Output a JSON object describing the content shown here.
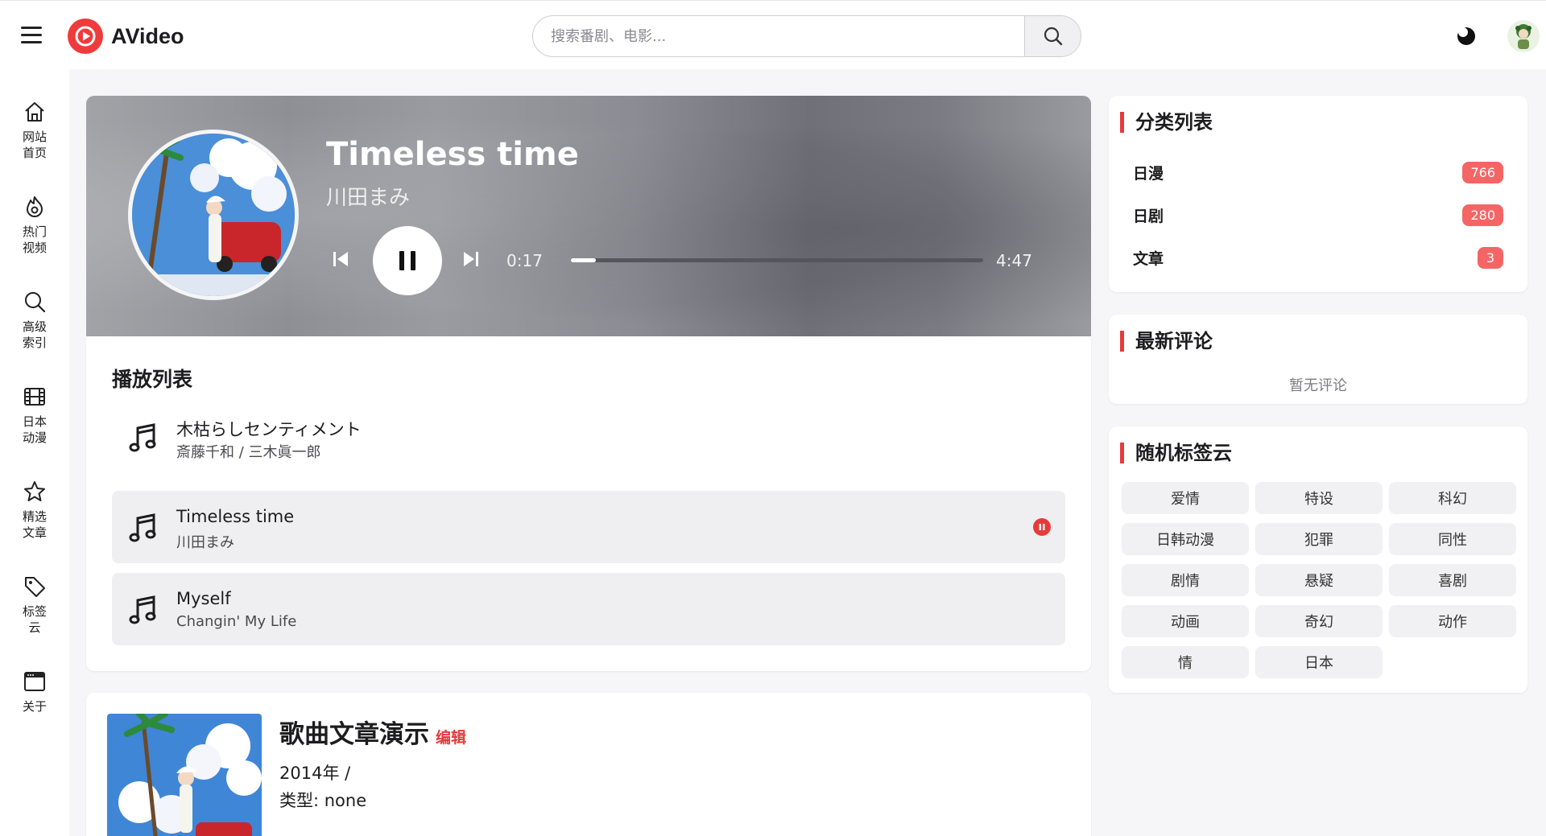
{
  "header": {
    "brand": "AVideo",
    "search_placeholder": "搜索番剧、电影..."
  },
  "sidebar": {
    "items": [
      {
        "label": "网站首页",
        "icon": "home-icon"
      },
      {
        "label": "热门视频",
        "icon": "fire-icon"
      },
      {
        "label": "高级索引",
        "icon": "search-icon"
      },
      {
        "label": "日本动漫",
        "icon": "film-icon"
      },
      {
        "label": "精选文章",
        "icon": "star-icon"
      },
      {
        "label": "标签云",
        "icon": "tag-icon"
      },
      {
        "label": "关于",
        "icon": "window-icon"
      }
    ]
  },
  "player": {
    "title": "Timeless time",
    "artist": "川田まみ",
    "current_time": "0:17",
    "total_time": "4:47",
    "progress": 0.06,
    "state": "playing"
  },
  "playlist": {
    "heading": "播放列表",
    "tracks": [
      {
        "title": "木枯らしセンティメント",
        "artist": "斎藤千和 / 三木眞一郎",
        "active": false
      },
      {
        "title": "Timeless time",
        "artist": "川田まみ",
        "active": true
      },
      {
        "title": "Myself",
        "artist": "Changin' My Life",
        "active": false
      }
    ]
  },
  "article": {
    "title": "歌曲文章演示",
    "edit_label": "编辑",
    "year_line": "2014年 /",
    "type_line": "类型:  none"
  },
  "categories": {
    "title": "分类列表",
    "items": [
      {
        "name": "日漫",
        "count": "766"
      },
      {
        "name": "日剧",
        "count": "280"
      },
      {
        "name": "文章",
        "count": "3"
      }
    ]
  },
  "comments": {
    "title": "最新评论",
    "empty_text": "暂无评论"
  },
  "tags": {
    "title": "随机标签云",
    "items": [
      "爱情",
      "特设",
      "科幻",
      "日韩动漫",
      "犯罪",
      "同性",
      "剧情",
      "悬疑",
      "喜剧",
      "动画",
      "奇幻",
      "动作",
      "情",
      "日本"
    ]
  },
  "colors": {
    "accent": "#e53b3b",
    "badge": "#f56565",
    "brand_red": "#ef3b3b"
  }
}
